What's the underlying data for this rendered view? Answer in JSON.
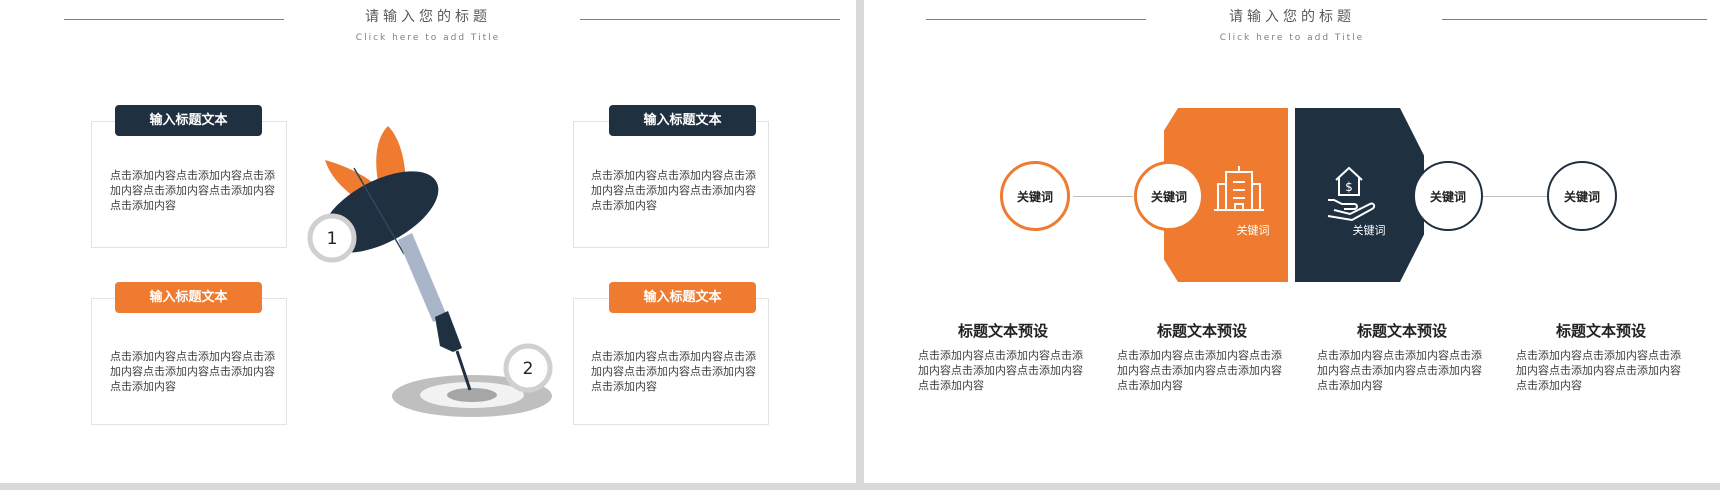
{
  "colors": {
    "orange": "#ee7b30",
    "navy": "#1f3041",
    "gray": "#bfbfbf"
  },
  "slide1": {
    "title": "请输入您的标题",
    "subtitle": "Click here to add Title",
    "cards": [
      {
        "label": "输入标题文本",
        "text": "点击添加内容点击添加内容点击添加内容点击添加内容点击添加内容点击添加内容"
      },
      {
        "label": "输入标题文本",
        "text": "点击添加内容点击添加内容点击添加内容点击添加内容点击添加内容点击添加内容"
      },
      {
        "label": "输入标题文本",
        "text": "点击添加内容点击添加内容点击添加内容点击添加内容点击添加内容点击添加内容"
      },
      {
        "label": "输入标题文本",
        "text": "点击添加内容点击添加内容点击添加内容点击添加内容点击添加内容点击添加内容"
      }
    ],
    "markers": [
      "1",
      "2"
    ]
  },
  "slide2": {
    "title": "请输入您的标题",
    "subtitle": "Click here to add Title",
    "keywords": [
      "关键词",
      "关键词",
      "关键词",
      "关键词"
    ],
    "hex_labels": [
      "关键词",
      "关键词"
    ],
    "icons": [
      "office-building-icon",
      "hand-house-dollar-icon"
    ],
    "columns": [
      {
        "title": "标题文本预设",
        "text": "点击添加内容点击添加内容点击添加内容点击添加内容点击添加内容点击添加内容"
      },
      {
        "title": "标题文本预设",
        "text": "点击添加内容点击添加内容点击添加内容点击添加内容点击添加内容点击添加内容"
      },
      {
        "title": "标题文本预设",
        "text": "点击添加内容点击添加内容点击添加内容点击添加内容点击添加内容点击添加内容"
      },
      {
        "title": "标题文本预设",
        "text": "点击添加内容点击添加内容点击添加内容点击添加内容点击添加内容点击添加内容"
      }
    ]
  }
}
